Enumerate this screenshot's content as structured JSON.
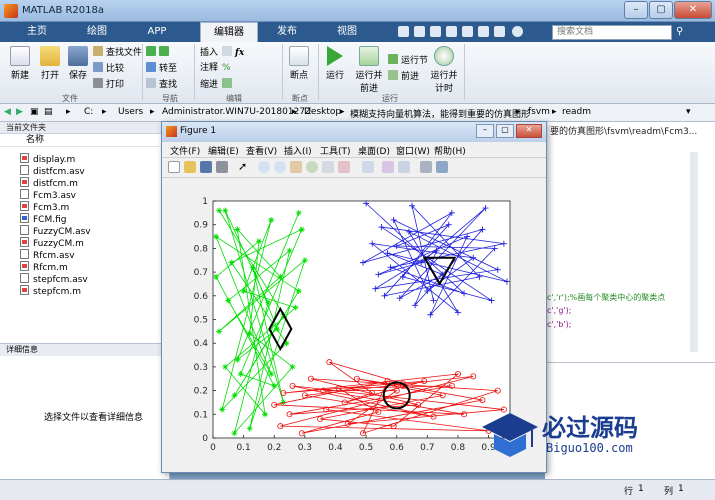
{
  "window": {
    "title": "MATLAB R2018a"
  },
  "ribbon_tabs": [
    "主页",
    "绘图",
    "APP",
    "编辑器",
    "发布",
    "视图"
  ],
  "search": {
    "placeholder": "搜索文档"
  },
  "ribbon": {
    "new": "新建",
    "open": "打开",
    "save": "保存",
    "find_files": "查找文件",
    "compare": "比较",
    "print": "打印",
    "goto": "转至",
    "find": "查找",
    "insert": "插入",
    "comment": "注释",
    "indent": "缩进",
    "breakpoints": "断点",
    "run": "运行",
    "run_advance": "运行并前进",
    "run_section": "运行节",
    "advance": "前进",
    "run_time": "运行并计时",
    "groups": {
      "file": "文件",
      "navigate": "导航",
      "edit": "编辑",
      "breakpoints": "断点",
      "run": "运行"
    }
  },
  "address": [
    "C:",
    "Users",
    "Administrator.WIN7U-20180127Z",
    "Desktop",
    "模糊支持向量机算法，能得到重要的仿真图形",
    "fsvm",
    "readm"
  ],
  "current_folder": {
    "header": "当前文件夹",
    "column": "名称",
    "files": [
      "display.m",
      "distfcm.asv",
      "distfcm.m",
      "Fcm3.asv",
      "Fcm3.m",
      "FCM.fig",
      "FuzzyCM.asv",
      "FuzzyCM.m",
      "Rfcm.asv",
      "Rfcm.m",
      "stepfcm.asv",
      "stepfcm.m"
    ]
  },
  "details": {
    "header": "详细信息",
    "message": "选择文件以查看详细信息"
  },
  "editor": {
    "path": "要的仿真图形\\fsvm\\readm\\Fcm3...",
    "code_lines": [
      "c','r');%画每个聚类中心的聚类点",
      "c','g');",
      "c','b');"
    ]
  },
  "status": {
    "row_label": "行",
    "row": "1",
    "col_label": "列",
    "col": "1"
  },
  "figure": {
    "title": "Figure 1",
    "menu": [
      "文件(F)",
      "编辑(E)",
      "查看(V)",
      "插入(I)",
      "工具(T)",
      "桌面(D)",
      "窗口(W)",
      "帮助(H)"
    ]
  },
  "chart_data": {
    "type": "scatter",
    "title": "",
    "xlabel": "",
    "ylabel": "",
    "xlim": [
      0,
      0.97
    ],
    "ylim": [
      0,
      1
    ],
    "xticks": [
      "0",
      "0.1",
      "0.2",
      "0.3",
      "0.4",
      "0.5",
      "0.6",
      "0.7",
      "0.8",
      "0.9"
    ],
    "yticks": [
      "0",
      "0.1",
      "0.2",
      "0.3",
      "0.4",
      "0.5",
      "0.6",
      "0.7",
      "0.8",
      "0.9",
      "1"
    ],
    "grid": false,
    "series": [
      {
        "color": "#00dd00",
        "marker": "star",
        "points": [
          [
            0.02,
            0.96
          ],
          [
            0.23,
            0.52
          ],
          [
            0.07,
            0.18
          ],
          [
            0.28,
            0.62
          ],
          [
            0.01,
            0.85
          ],
          [
            0.19,
            0.27
          ],
          [
            0.05,
            0.58
          ],
          [
            0.25,
            0.79
          ],
          [
            0.12,
            0.04
          ],
          [
            0.3,
            0.75
          ],
          [
            0.02,
            0.45
          ],
          [
            0.22,
            0.68
          ],
          [
            0.08,
            0.88
          ],
          [
            0.17,
            0.1
          ],
          [
            0.04,
            0.3
          ],
          [
            0.27,
            0.55
          ],
          [
            0.1,
            0.62
          ],
          [
            0.19,
            0.92
          ],
          [
            0.03,
            0.12
          ],
          [
            0.24,
            0.4
          ],
          [
            0.06,
            0.74
          ],
          [
            0.29,
            0.88
          ],
          [
            0.09,
            0.27
          ],
          [
            0.2,
            0.22
          ],
          [
            0.01,
            0.68
          ],
          [
            0.15,
            0.83
          ],
          [
            0.12,
            0.44
          ],
          [
            0.26,
            0.3
          ],
          [
            0.07,
            0.02
          ],
          [
            0.18,
            0.57
          ],
          [
            0.04,
            0.96
          ],
          [
            0.23,
            0.15
          ],
          [
            0.13,
            0.72
          ],
          [
            0.21,
            0.46
          ],
          [
            0.08,
            0.33
          ],
          [
            0.28,
            0.95
          ]
        ]
      },
      {
        "color": "#2222dd",
        "marker": "plus",
        "points": [
          [
            0.5,
            0.99
          ],
          [
            0.82,
            0.61
          ],
          [
            0.58,
            0.72
          ],
          [
            0.95,
            0.82
          ],
          [
            0.55,
            0.89
          ],
          [
            0.91,
            0.58
          ],
          [
            0.62,
            0.68
          ],
          [
            0.78,
            0.95
          ],
          [
            0.49,
            0.74
          ],
          [
            0.88,
            0.88
          ],
          [
            0.66,
            0.56
          ],
          [
            0.73,
            0.79
          ],
          [
            0.53,
            0.63
          ],
          [
            0.93,
            0.71
          ],
          [
            0.59,
            0.92
          ],
          [
            0.7,
            0.62
          ],
          [
            0.85,
            0.76
          ],
          [
            0.52,
            0.82
          ],
          [
            0.8,
            0.53
          ],
          [
            0.64,
            0.87
          ],
          [
            0.96,
            0.66
          ],
          [
            0.57,
            0.78
          ],
          [
            0.75,
            0.69
          ],
          [
            0.61,
            0.59
          ],
          [
            0.89,
            0.97
          ],
          [
            0.68,
            0.74
          ],
          [
            0.54,
            0.69
          ],
          [
            0.83,
            0.85
          ],
          [
            0.71,
            0.52
          ],
          [
            0.92,
            0.8
          ],
          [
            0.6,
            0.81
          ],
          [
            0.77,
            0.9
          ],
          [
            0.56,
            0.6
          ],
          [
            0.87,
            0.68
          ],
          [
            0.65,
            0.98
          ],
          [
            0.72,
            0.58
          ]
        ]
      },
      {
        "color": "#ee1111",
        "marker": "circle",
        "points": [
          [
            0.37,
            0.12
          ],
          [
            0.9,
            0.03
          ],
          [
            0.22,
            0.05
          ],
          [
            0.85,
            0.26
          ],
          [
            0.3,
            0.18
          ],
          [
            0.72,
            0.09
          ],
          [
            0.26,
            0.22
          ],
          [
            0.95,
            0.12
          ],
          [
            0.44,
            0.06
          ],
          [
            0.6,
            0.2
          ],
          [
            0.36,
            0.2
          ],
          [
            0.82,
            0.1
          ],
          [
            0.2,
            0.14
          ],
          [
            0.57,
            0.24
          ],
          [
            0.49,
            0.02
          ],
          [
            0.93,
            0.2
          ],
          [
            0.32,
            0.25
          ],
          [
            0.67,
            0.14
          ],
          [
            0.25,
            0.1
          ],
          [
            0.78,
            0.22
          ],
          [
            0.41,
            0.21
          ],
          [
            0.54,
            0.11
          ],
          [
            0.29,
            0.02
          ],
          [
            0.88,
            0.16
          ],
          [
            0.62,
            0.22
          ],
          [
            0.47,
            0.25
          ],
          [
            0.75,
            0.18
          ],
          [
            0.35,
            0.08
          ],
          [
            0.59,
            0.05
          ],
          [
            0.8,
            0.27
          ],
          [
            0.23,
            0.19
          ],
          [
            0.69,
            0.24
          ],
          [
            0.43,
            0.15
          ],
          [
            0.52,
            0.19
          ],
          [
            0.38,
            0.32
          ],
          [
            0.62,
            0.23
          ]
        ]
      }
    ],
    "centers": [
      {
        "x": 0.22,
        "y": 0.46,
        "marker": "diamond",
        "color": "#000000"
      },
      {
        "x": 0.74,
        "y": 0.71,
        "marker": "triangle-down",
        "color": "#000000"
      },
      {
        "x": 0.6,
        "y": 0.18,
        "marker": "circle",
        "color": "#000000"
      }
    ]
  },
  "watermark": {
    "text": "必过源码",
    "sub": "Biguo100.com"
  }
}
